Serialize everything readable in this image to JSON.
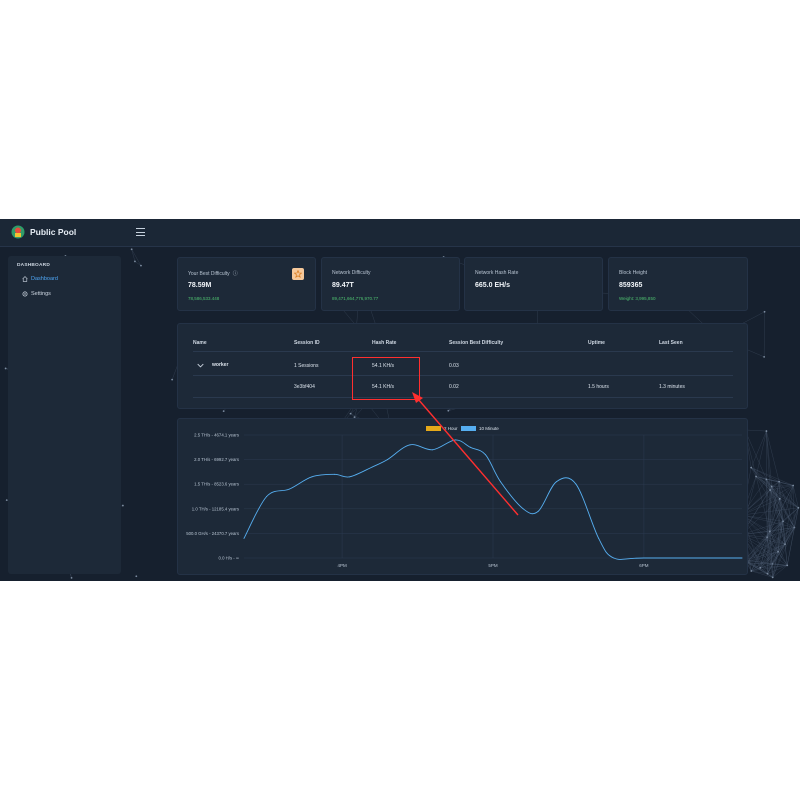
{
  "app": {
    "title": "Public Pool"
  },
  "sidebar": {
    "section": "DASHBOARD",
    "items": [
      {
        "label": "Dashboard",
        "icon": "home-icon",
        "active": true
      },
      {
        "label": "Settings",
        "icon": "gear-icon",
        "active": false
      }
    ]
  },
  "cards": [
    {
      "label": "Your Best Difficulty",
      "value": "78.59M",
      "sub": "78,586,533.448"
    },
    {
      "label": "Network Difficulty",
      "value": "89.47T",
      "sub": "89,471,664,776,970.77"
    },
    {
      "label": "Network Hash Rate",
      "value": "665.0 EH/s",
      "sub": ""
    },
    {
      "label": "Block Height",
      "value": "859365",
      "sub": "Weight: 3,995,850"
    }
  ],
  "table": {
    "headers": [
      "Name",
      "Session ID",
      "Hash Rate",
      "Session Best Difficulty",
      "Uptime",
      "Last Seen"
    ],
    "worker": {
      "name": "worker",
      "sessions": "1 Sessions",
      "hash_rate": "54.1 KH/s",
      "best": "0.03"
    },
    "session": {
      "id": "3e3bf404",
      "hash_rate": "54.1 KH/s",
      "best": "0.02",
      "uptime": "1.5 hours",
      "last_seen": "1.3 minutes"
    }
  },
  "colors": {
    "accent": "#4ea6f5",
    "green": "#4ec070",
    "series_2hour": "#e5a91a",
    "series_10min": "#56aef0",
    "highlight": "#ff2f2f"
  },
  "chart_data": {
    "type": "line",
    "legend": {
      "placement": "top-center"
    },
    "series": [
      {
        "name": "2 Hour",
        "color": "#e5a91a"
      },
      {
        "name": "10 Minute",
        "color": "#56aef0"
      }
    ],
    "y_tick_labels": [
      "2.5 TH/s - 4674.1 years",
      "2.0 TH/s - 6992.7 years",
      "1.5 TH/s - 8523.6 years",
      "1.0 TH/s - 12185.4 years",
      "500.0 GH/s - 24370.7 years",
      "0.0 H/s - ∞"
    ],
    "x_tick_labels": [
      "4PM",
      "5PM",
      "6PM"
    ],
    "ylim": [
      0,
      2.5
    ],
    "y_unit": "TH/s",
    "x_range_hours": [
      15.35,
      18.65
    ],
    "x_ticks_hours": [
      16,
      17,
      18
    ],
    "values_10min": [
      [
        15.35,
        0.4
      ],
      [
        15.5,
        1.25
      ],
      [
        15.65,
        1.4
      ],
      [
        15.8,
        1.65
      ],
      [
        15.95,
        1.7
      ],
      [
        16.05,
        1.65
      ],
      [
        16.2,
        1.85
      ],
      [
        16.3,
        2.0
      ],
      [
        16.45,
        2.3
      ],
      [
        16.6,
        2.2
      ],
      [
        16.75,
        2.4
      ],
      [
        16.85,
        2.25
      ],
      [
        16.95,
        2.1
      ],
      [
        17.05,
        1.55
      ],
      [
        17.2,
        1.0
      ],
      [
        17.3,
        0.95
      ],
      [
        17.42,
        1.55
      ],
      [
        17.55,
        1.5
      ],
      [
        17.7,
        0.4
      ],
      [
        17.8,
        0.0
      ],
      [
        18.0,
        0.0
      ],
      [
        18.65,
        0.0
      ]
    ],
    "grid": true
  },
  "annotation": {
    "type": "red-rectangle-with-arrow",
    "target": "hash-rate-column"
  }
}
